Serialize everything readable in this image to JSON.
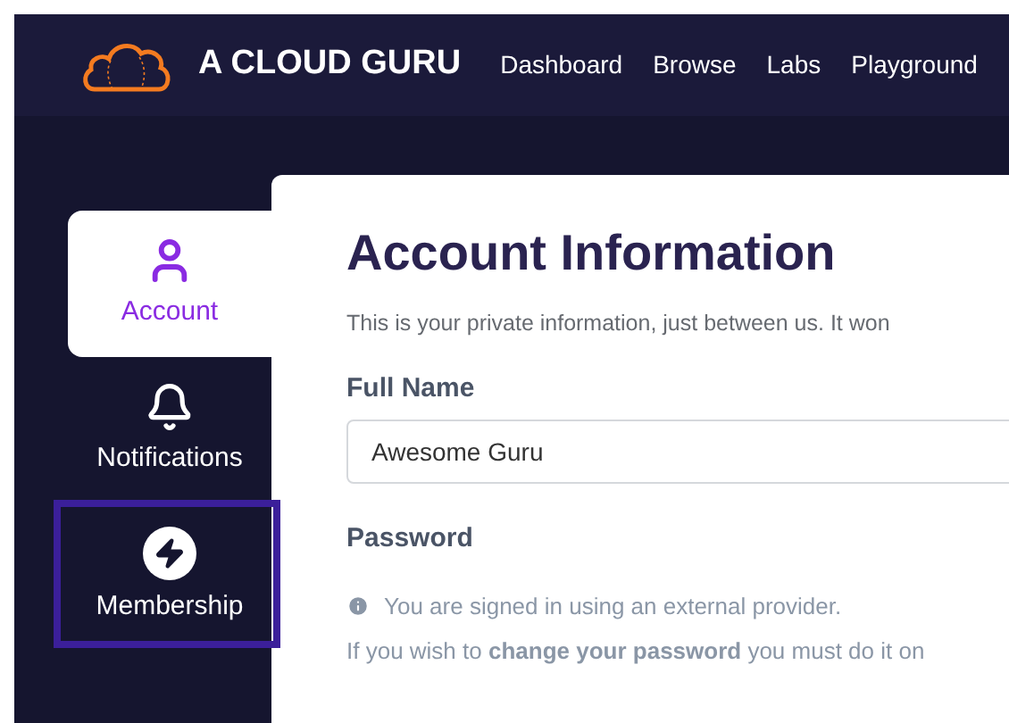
{
  "navbar": {
    "brand": "A CLOUD GURU",
    "links": [
      "Dashboard",
      "Browse",
      "Labs",
      "Playground"
    ]
  },
  "sidebar": {
    "items": [
      {
        "kind": "person",
        "label": "Account",
        "selected": true,
        "highlighted": false
      },
      {
        "kind": "bell",
        "label": "Notifications",
        "selected": false,
        "highlighted": false
      },
      {
        "kind": "bolt",
        "label": "Membership",
        "selected": false,
        "highlighted": true
      }
    ]
  },
  "content": {
    "title": "Account Information",
    "description": "This is your private information, just between us. It won",
    "full_name": {
      "label": "Full Name",
      "value": "Awesome Guru"
    },
    "password": {
      "label": "Password",
      "notice": "You are signed in using an external provider.",
      "hint": "If you wish to **change your password** you must do it on"
    }
  }
}
